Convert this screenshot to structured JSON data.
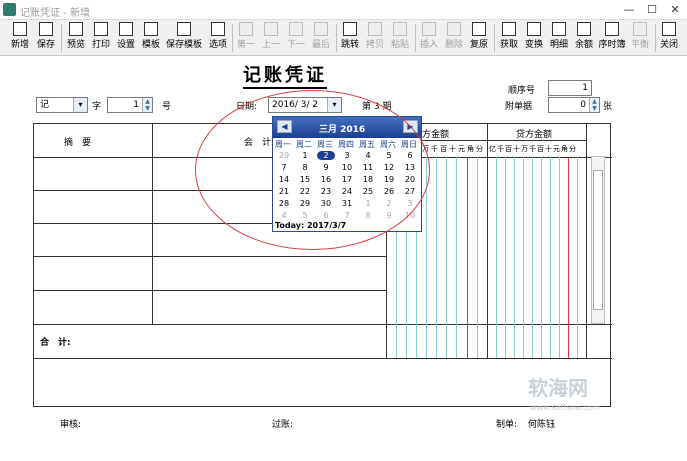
{
  "window": {
    "title": "记账凭证 - 新增",
    "min": "—",
    "max": "☐",
    "close": "✕"
  },
  "toolbar": {
    "items": [
      {
        "label": "新增",
        "icon": "new-icon",
        "enabled": true
      },
      {
        "label": "保存",
        "icon": "save-icon",
        "enabled": true
      },
      {
        "label": "预览",
        "icon": "preview-icon",
        "enabled": true
      },
      {
        "label": "打印",
        "icon": "print-icon",
        "enabled": true
      },
      {
        "label": "设置",
        "icon": "settings-icon",
        "enabled": true
      },
      {
        "label": "模板",
        "icon": "template-icon",
        "enabled": true
      },
      {
        "label": "保存模板",
        "icon": "save-template-icon",
        "enabled": true
      },
      {
        "label": "选项",
        "icon": "options-icon",
        "enabled": true
      },
      {
        "label": "第一",
        "icon": "first-icon",
        "enabled": false
      },
      {
        "label": "上一",
        "icon": "prev-icon",
        "enabled": false
      },
      {
        "label": "下一",
        "icon": "next-icon",
        "enabled": false
      },
      {
        "label": "最后",
        "icon": "last-icon",
        "enabled": false
      },
      {
        "label": "跳转",
        "icon": "goto-icon",
        "enabled": true
      },
      {
        "label": "拷贝",
        "icon": "copy-icon",
        "enabled": false
      },
      {
        "label": "粘贴",
        "icon": "paste-icon",
        "enabled": false
      },
      {
        "label": "插入",
        "icon": "insert-icon",
        "enabled": false
      },
      {
        "label": "删除",
        "icon": "delete-icon",
        "enabled": false
      },
      {
        "label": "复原",
        "icon": "restore-icon",
        "enabled": true
      },
      {
        "label": "获取",
        "icon": "fetch-icon",
        "enabled": true
      },
      {
        "label": "变换",
        "icon": "transform-icon",
        "enabled": true
      },
      {
        "label": "明细",
        "icon": "detail-icon",
        "enabled": true
      },
      {
        "label": "余额",
        "icon": "balance-icon",
        "enabled": true
      },
      {
        "label": "序时簿",
        "icon": "journal-icon",
        "enabled": true
      },
      {
        "label": "平衡",
        "icon": "balance-scale-icon",
        "enabled": false
      },
      {
        "label": "关闭",
        "icon": "close-doc-icon",
        "enabled": true
      }
    ]
  },
  "voucher": {
    "heading": "记账凭证",
    "word_value": "记",
    "word_label": "字",
    "number_value": "1",
    "number_label": "号",
    "date_label": "日期:",
    "date_value": "2016/ 3/ 2",
    "period_label": "第 3 期",
    "seq_label": "顺序号",
    "seq_value": "1",
    "attach_label": "附单据",
    "attach_value": "0",
    "attach_unit": "张"
  },
  "table": {
    "col_summary": "摘　要",
    "col_account": "会　计",
    "col_debit": "方金额",
    "col_credit": "贷方金额",
    "debit_digits": "万千百十元角分",
    "credit_digits": "亿千百十万千百十元角分",
    "total_label": "合　计:"
  },
  "calendar": {
    "title": "三月  2016",
    "weekdays": [
      "周一",
      "周二",
      "周三",
      "周四",
      "周五",
      "周六",
      "周日"
    ],
    "rows": [
      [
        "29",
        "1",
        "2",
        "3",
        "4",
        "5",
        "6"
      ],
      [
        "7",
        "8",
        "9",
        "10",
        "11",
        "12",
        "13"
      ],
      [
        "14",
        "15",
        "16",
        "17",
        "18",
        "19",
        "20"
      ],
      [
        "21",
        "22",
        "23",
        "24",
        "25",
        "26",
        "27"
      ],
      [
        "28",
        "29",
        "30",
        "31",
        "1",
        "2",
        "3"
      ],
      [
        "4",
        "5",
        "6",
        "7",
        "8",
        "9",
        "10"
      ]
    ],
    "today_label": "Today: 2017/3/7"
  },
  "footer": {
    "audit": "审核:",
    "post": "过账:",
    "maker_label": "制单:",
    "maker": "何陈钰"
  },
  "watermark": {
    "logo": "软海网",
    "url": "www.softsea.com"
  }
}
